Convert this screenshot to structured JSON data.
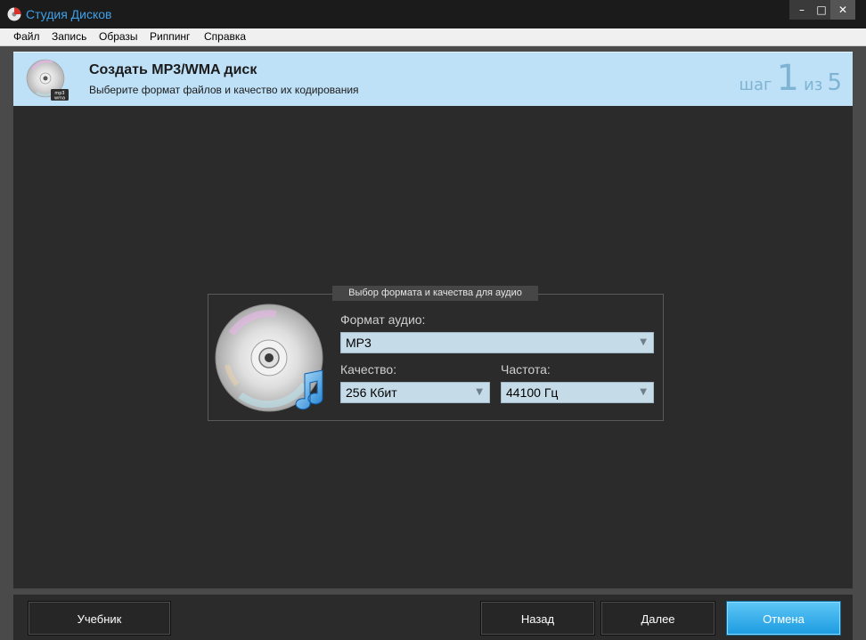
{
  "window": {
    "title": "Студия Дисков",
    "controls": {
      "minimize": "–",
      "maximize": "□",
      "close": "✕"
    }
  },
  "menu": {
    "items": [
      "Файл",
      "Запись",
      "Образы",
      "Риппинг",
      "Справка"
    ]
  },
  "header": {
    "icon": "mp3-wma-disc-icon",
    "icon_badge": "mp3 wma",
    "title": "Создать MP3/WMA диск",
    "subtitle": "Выберите формат файлов и качество их кодирования",
    "step_word": "шаг",
    "step_current": "1",
    "step_of": "из",
    "step_total": "5"
  },
  "audio_group": {
    "legend": "Выбор формата и качества для аудио",
    "format_label": "Формат аудио:",
    "format_value": "MP3",
    "quality_label": "Качество:",
    "quality_value": "256 Кбит",
    "frequency_label": "Частота:",
    "frequency_value": "44100 Гц"
  },
  "buttons": {
    "tutorial": "Учебник",
    "back": "Назад",
    "next": "Далее",
    "cancel": "Отмена"
  },
  "colors": {
    "accent": "#1c9be0",
    "header_bg": "#bfe1f7",
    "title_text": "#3fa0e8"
  }
}
